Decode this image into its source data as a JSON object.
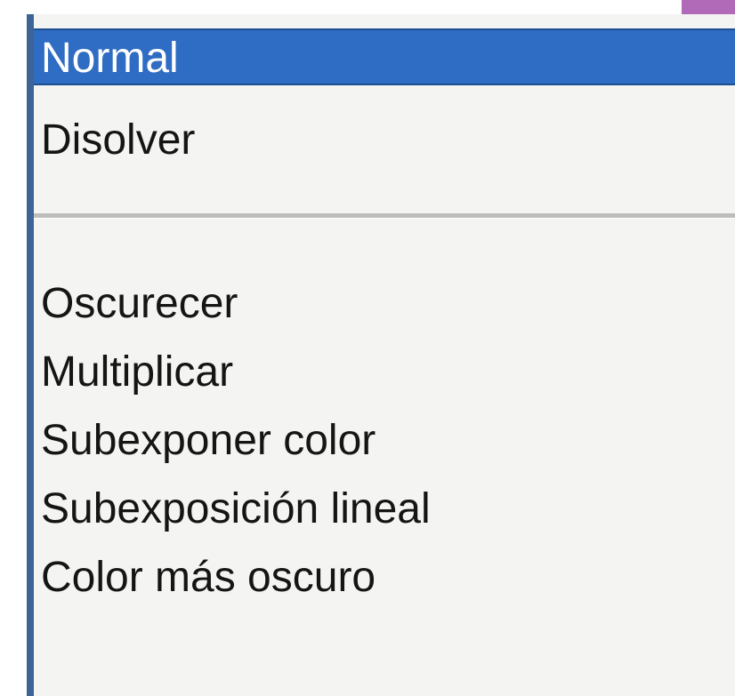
{
  "menu": {
    "selected": "Normal",
    "items": [
      {
        "label": "Normal"
      },
      {
        "label": "Disolver"
      },
      {
        "label": "Oscurecer"
      },
      {
        "label": "Multiplicar"
      },
      {
        "label": "Subexponer color"
      },
      {
        "label": "Subexposición lineal"
      },
      {
        "label": "Color más oscuro"
      }
    ]
  },
  "colors": {
    "selection": "#2f6cc3",
    "left_border": "#3c6497",
    "menu_background": "#f4f4f2",
    "corner_accent": "#b06ab8"
  }
}
